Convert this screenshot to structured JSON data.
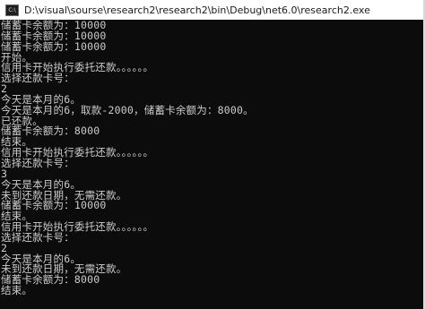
{
  "window": {
    "title": "D:\\visual\\sourse\\research2\\research2\\bin\\Debug\\net6.0\\research2.exe",
    "icon_name": "console-app-icon",
    "icon_label": "C:\\"
  },
  "colors": {
    "background": "#0c0c0c",
    "text": "#cccccc",
    "titlebar": "#ffffff"
  },
  "console": {
    "lines": [
      "储蓄卡余额为：10000",
      "储蓄卡余额为：10000",
      "储蓄卡余额为：10000",
      "开始。",
      "信用卡开始执行委托还款。。。。。。",
      "选择还款卡号：",
      "2",
      "今天是本月的6。",
      "今天是本月的6，取款-2000，储蓄卡余额为：8000。",
      "已还款。",
      "储蓄卡余额为：8000",
      "结束。",
      "信用卡开始执行委托还款。。。。。。",
      "选择还款卡号：",
      "3",
      "今天是本月的6。",
      "未到还款日期，无需还款。",
      "储蓄卡余额为：10000",
      "结束。",
      "信用卡开始执行委托还款。。。。。。",
      "选择还款卡号：",
      "2",
      "今天是本月的6。",
      "未到还款日期，无需还款。",
      "储蓄卡余额为：8000",
      "结束。"
    ]
  }
}
